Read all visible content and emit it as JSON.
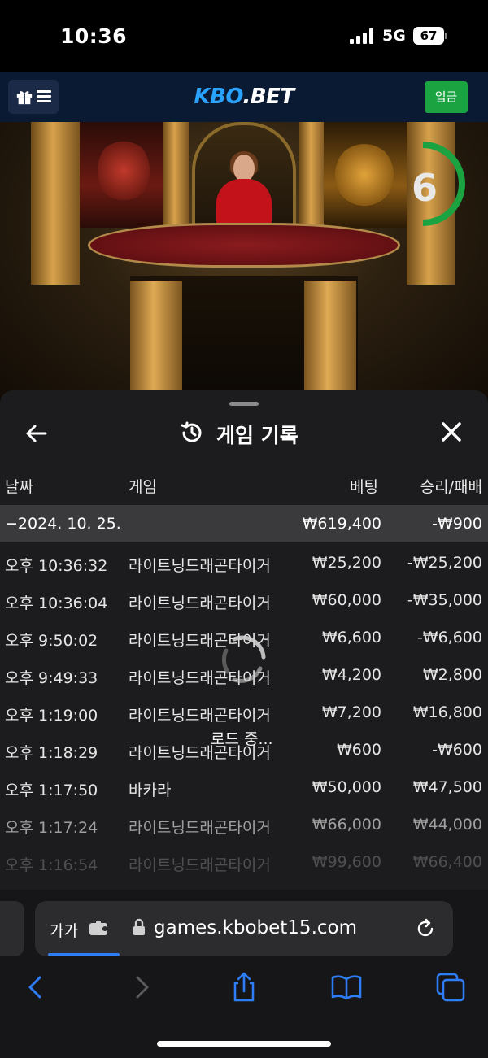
{
  "status_bar": {
    "time": "10:36",
    "network": "5G",
    "battery": "67"
  },
  "header": {
    "logo_part1": "KBO",
    "logo_part2": ".BET",
    "deposit_label": "입금"
  },
  "video": {
    "countdown": "6"
  },
  "history": {
    "title": "게임 기록",
    "columns": {
      "date": "날짜",
      "game": "게임",
      "bet": "베팅",
      "win_loss": "승리/패배"
    },
    "day_summary": {
      "date": "−2024. 10. 25.",
      "bet": "₩619,400",
      "win_loss": "-₩900"
    },
    "rows": [
      {
        "time": "오후 10:36:32",
        "game": "라이트닝드래곤타이거",
        "bet": "₩25,200",
        "win_loss": "-₩25,200"
      },
      {
        "time": "오후 10:36:04",
        "game": "라이트닝드래곤타이거",
        "bet": "₩60,000",
        "win_loss": "-₩35,000"
      },
      {
        "time": "오후 9:50:02",
        "game": "라이트닝드래곤타이거",
        "bet": "₩6,600",
        "win_loss": "-₩6,600"
      },
      {
        "time": "오후 9:49:33",
        "game": "라이트닝드래곤타이거",
        "bet": "₩4,200",
        "win_loss": "₩2,800"
      },
      {
        "time": "오후 1:19:00",
        "game": "라이트닝드래곤타이거",
        "bet": "₩7,200",
        "win_loss": "₩16,800"
      },
      {
        "time": "오후 1:18:29",
        "game": "라이트닝드래곤타이거",
        "bet": "₩600",
        "win_loss": "-₩600"
      },
      {
        "time": "오후 1:17:50",
        "game": "바카라",
        "bet": "₩50,000",
        "win_loss": "₩47,500"
      },
      {
        "time": "오후 1:17:24",
        "game": "라이트닝드래곤타이거",
        "bet": "₩66,000",
        "win_loss": "₩44,000"
      },
      {
        "time": "오후 1:16:54",
        "game": "라이트닝드래곤타이거",
        "bet": "₩99,600",
        "win_loss": "₩66,400"
      }
    ],
    "loading_text": "로드 중..."
  },
  "browser": {
    "text_size_label": "가가",
    "url": "games.kbobet15.com"
  },
  "icons": {
    "gift": "gift-icon",
    "menu": "hamburger-icon",
    "back": "arrow-left-icon",
    "close": "close-icon",
    "history": "history-icon",
    "lock": "lock-icon",
    "reload": "reload-icon",
    "share": "share-icon",
    "bookmarks": "book-icon",
    "tabs": "tabs-icon"
  },
  "colors": {
    "accent_blue": "#2aa3ff",
    "deposit_green": "#1aa340",
    "timer_green": "#1aa340",
    "safari_blue": "#2f7df6"
  }
}
